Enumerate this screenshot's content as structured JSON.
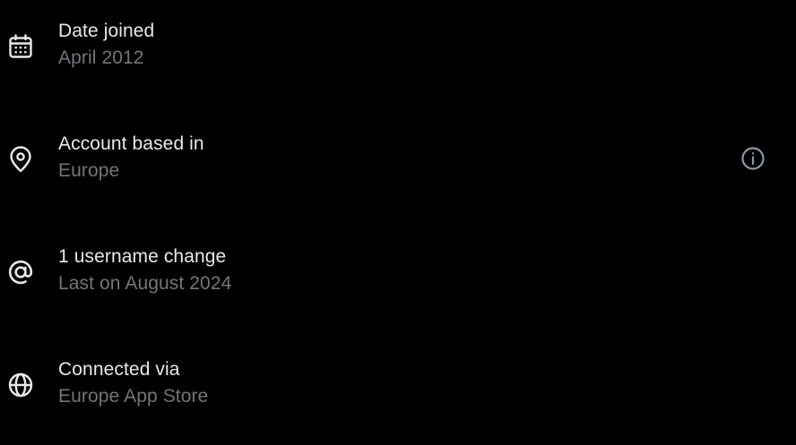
{
  "rows": [
    {
      "icon": "calendar-icon",
      "title": "Date joined",
      "subtitle": "April 2012"
    },
    {
      "icon": "location-pin-icon",
      "title": "Account based in",
      "subtitle": "Europe",
      "has_info": true
    },
    {
      "icon": "at-sign-icon",
      "title": "1 username change",
      "subtitle": "Last on August 2024"
    },
    {
      "icon": "globe-icon",
      "title": "Connected via",
      "subtitle": "Europe App Store"
    }
  ],
  "colors": {
    "background": "#000000",
    "primary_text": "#e7e9ea",
    "secondary_text": "#71767b"
  }
}
